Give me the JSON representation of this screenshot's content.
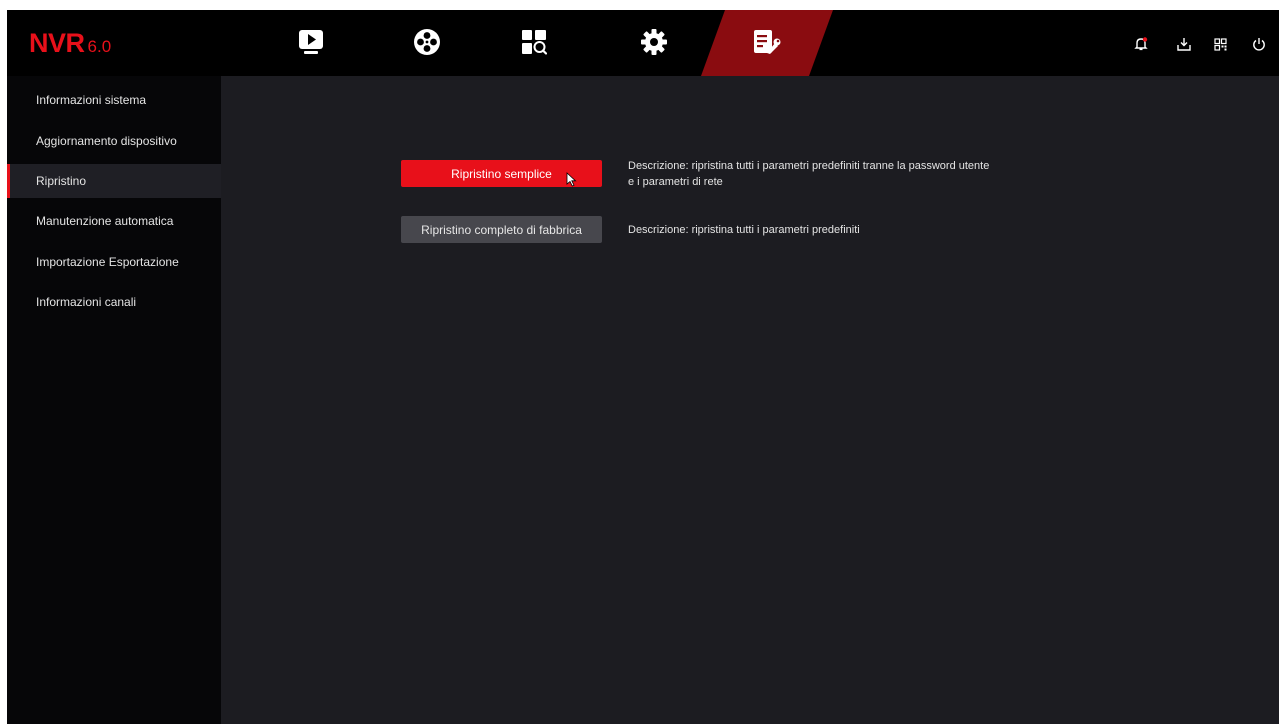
{
  "app": {
    "brand": "NVR",
    "version": "6.0"
  },
  "nav": {
    "tabs": [
      {
        "icon": "live-view-icon"
      },
      {
        "icon": "playback-icon"
      },
      {
        "icon": "search-icon"
      },
      {
        "icon": "settings-icon"
      },
      {
        "icon": "maintenance-icon",
        "active": true
      }
    ]
  },
  "toolbar": {
    "icons": [
      "alarm-bell-icon",
      "download-icon",
      "qr-code-icon",
      "power-icon"
    ]
  },
  "sidebar": {
    "items": [
      {
        "label": "Informazioni sistema"
      },
      {
        "label": "Aggiornamento dispositivo"
      },
      {
        "label": "Ripristino",
        "active": true
      },
      {
        "label": "Manutenzione automatica"
      },
      {
        "label": "Importazione Esportazione"
      },
      {
        "label": "Informazioni canali"
      }
    ]
  },
  "main": {
    "simple_reset": {
      "button_label": "Ripristino semplice",
      "description_line1": "Descrizione: ripristina tutti i parametri predefiniti tranne la password utente",
      "description_line2": "e i parametri di rete"
    },
    "factory_reset": {
      "button_label": "Ripristino completo di fabbrica",
      "description": "Descrizione: ripristina tutti i parametri predefiniti"
    }
  },
  "colors": {
    "accent": "#e8101a",
    "accent_dark": "#8a0c10",
    "background": "#1c1c21",
    "sidebar": "#060608",
    "topbar": "#000000"
  }
}
